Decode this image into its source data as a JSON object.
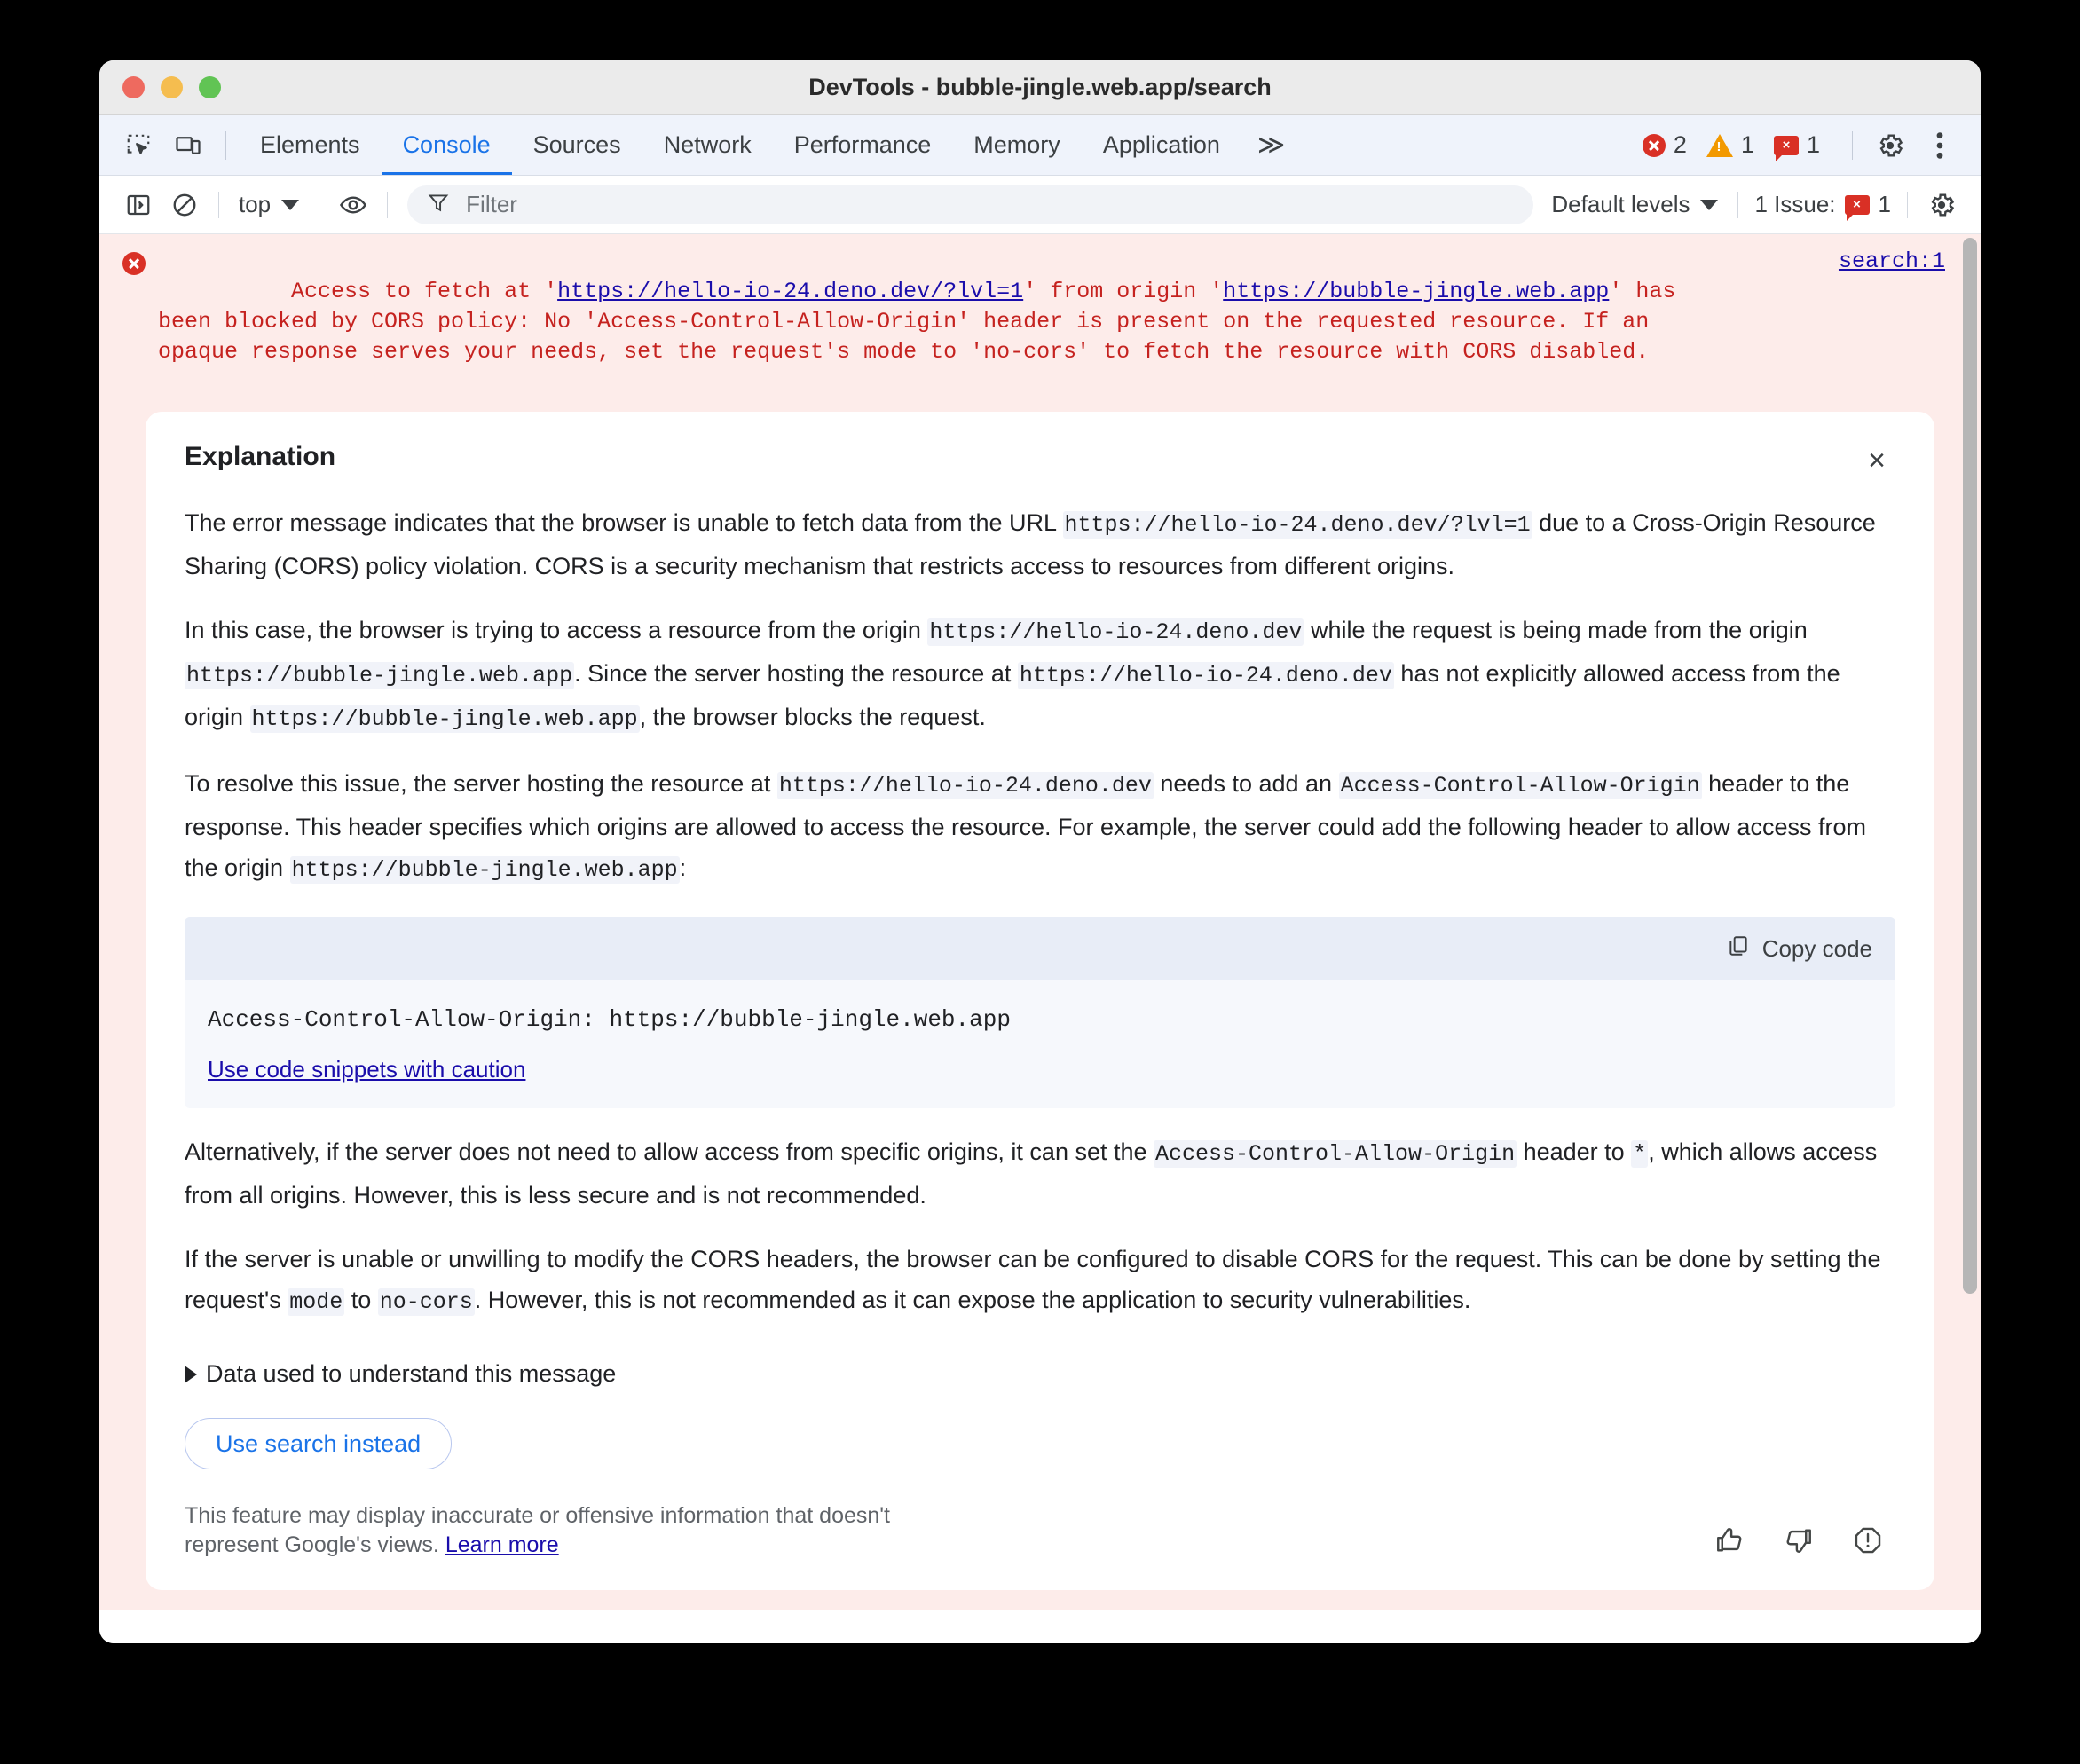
{
  "window": {
    "title": "DevTools - bubble-jingle.web.app/search",
    "traffic_lights": [
      "close",
      "minimize",
      "zoom"
    ]
  },
  "tabbar": {
    "icons": [
      {
        "name": "inspect-element-icon",
        "label": "Inspect element"
      },
      {
        "name": "device-toolbar-icon",
        "label": "Toggle device toolbar"
      }
    ],
    "tabs": [
      {
        "label": "Elements",
        "active": false
      },
      {
        "label": "Console",
        "active": true
      },
      {
        "label": "Sources",
        "active": false
      },
      {
        "label": "Network",
        "active": false
      },
      {
        "label": "Performance",
        "active": false
      },
      {
        "label": "Memory",
        "active": false
      },
      {
        "label": "Application",
        "active": false
      }
    ],
    "more_label": "≫",
    "counters": [
      {
        "icon": "error-icon",
        "count": "2"
      },
      {
        "icon": "warning-icon",
        "count": "1"
      },
      {
        "icon": "issue-icon",
        "count": "1"
      }
    ],
    "settings_label": "Settings",
    "menu_label": "Customize and control DevTools"
  },
  "console_toolbar": {
    "sidebar_toggle_label": "Show console sidebar",
    "clear_label": "Clear console",
    "context_value": "top",
    "eye_label": "Create live expression",
    "filter": {
      "placeholder": "Filter",
      "value": ""
    },
    "levels_value": "Default levels",
    "issues_label": "1 Issue:",
    "issues_count": "1",
    "settings_label": "Console settings"
  },
  "console": {
    "error": {
      "line1_pre": "Access to fetch at '",
      "link1": "https://hello-io-24.deno.dev/?lvl=1",
      "line1_mid": "' from origin '",
      "link2": "https://bubble-jingle.web.app",
      "line1_post": "' has",
      "rest": "been blocked by CORS policy: No 'Access-Control-Allow-Origin' header is present on the requested resource. If an\nopaque response serves your needs, set the request's mode to 'no-cors' to fetch the resource with CORS disabled.",
      "source": "search:1"
    }
  },
  "explanation": {
    "title": "Explanation",
    "close_label": "×",
    "paragraphs": [
      {
        "parts": [
          {
            "t": "text",
            "v": "The error message indicates that the browser is unable to fetch data from the URL "
          },
          {
            "t": "code",
            "v": "https://hello-io-24.deno.dev/?lvl=1"
          },
          {
            "t": "text",
            "v": " due to a Cross-Origin Resource Sharing (CORS) policy violation. CORS is a security mechanism that restricts access to resources from different origins."
          }
        ]
      },
      {
        "parts": [
          {
            "t": "text",
            "v": "In this case, the browser is trying to access a resource from the origin "
          },
          {
            "t": "code",
            "v": "https://hello-io-24.deno.dev"
          },
          {
            "t": "text",
            "v": " while the request is being made from the origin "
          },
          {
            "t": "code",
            "v": "https://bubble-jingle.web.app"
          },
          {
            "t": "text",
            "v": ". Since the server hosting the resource at "
          },
          {
            "t": "code",
            "v": "https://hello-io-24.deno.dev"
          },
          {
            "t": "text",
            "v": " has not explicitly allowed access from the origin "
          },
          {
            "t": "code",
            "v": "https://bubble-jingle.web.app"
          },
          {
            "t": "text",
            "v": ", the browser blocks the request."
          }
        ]
      },
      {
        "parts": [
          {
            "t": "text",
            "v": "To resolve this issue, the server hosting the resource at "
          },
          {
            "t": "code",
            "v": "https://hello-io-24.deno.dev"
          },
          {
            "t": "text",
            "v": " needs to add an "
          },
          {
            "t": "code",
            "v": "Access-Control-Allow-Origin"
          },
          {
            "t": "text",
            "v": " header to the response. This header specifies which origins are allowed to access the resource. For example, the server could add the following header to allow access from the origin "
          },
          {
            "t": "code",
            "v": "https://bubble-jingle.web.app"
          },
          {
            "t": "text",
            "v": ":"
          }
        ]
      }
    ],
    "codeblock": {
      "copy_label": "Copy code",
      "copy_icon": "copy-icon",
      "code": "Access-Control-Allow-Origin: https://bubble-jingle.web.app",
      "caution_link": "Use code snippets with caution"
    },
    "paragraphs_after": [
      {
        "parts": [
          {
            "t": "text",
            "v": "Alternatively, if the server does not need to allow access from specific origins, it can set the "
          },
          {
            "t": "code",
            "v": "Access-Control-Allow-Origin"
          },
          {
            "t": "text",
            "v": " header to "
          },
          {
            "t": "code",
            "v": "*"
          },
          {
            "t": "text",
            "v": ", which allows access from all origins. However, this is less secure and is not recommended."
          }
        ]
      },
      {
        "parts": [
          {
            "t": "text",
            "v": "If the server is unable or unwilling to modify the CORS headers, the browser can be configured to disable CORS for the request. This can be done by setting the request's "
          },
          {
            "t": "code",
            "v": "mode"
          },
          {
            "t": "text",
            "v": " to "
          },
          {
            "t": "code",
            "v": "no-cors"
          },
          {
            "t": "text",
            "v": ". However, this is not recommended as it can expose the application to security vulnerabilities."
          }
        ]
      }
    ],
    "disclosure_label": "Data used to understand this message",
    "search_button_label": "Use search instead",
    "footer_text": "This feature may display inaccurate or offensive information that doesn't represent Google's views. ",
    "footer_link": "Learn more",
    "feedback_icons": [
      {
        "name": "thumb-up-icon",
        "label": "Good response"
      },
      {
        "name": "thumb-down-icon",
        "label": "Bad response"
      },
      {
        "name": "report-icon",
        "label": "Report"
      }
    ]
  },
  "colors": {
    "accent": "#1a73e8",
    "error_bg": "#fdecea",
    "error_text": "#c5221f",
    "link": "#1a0dab",
    "tabbar_bg": "#eff3fb"
  }
}
